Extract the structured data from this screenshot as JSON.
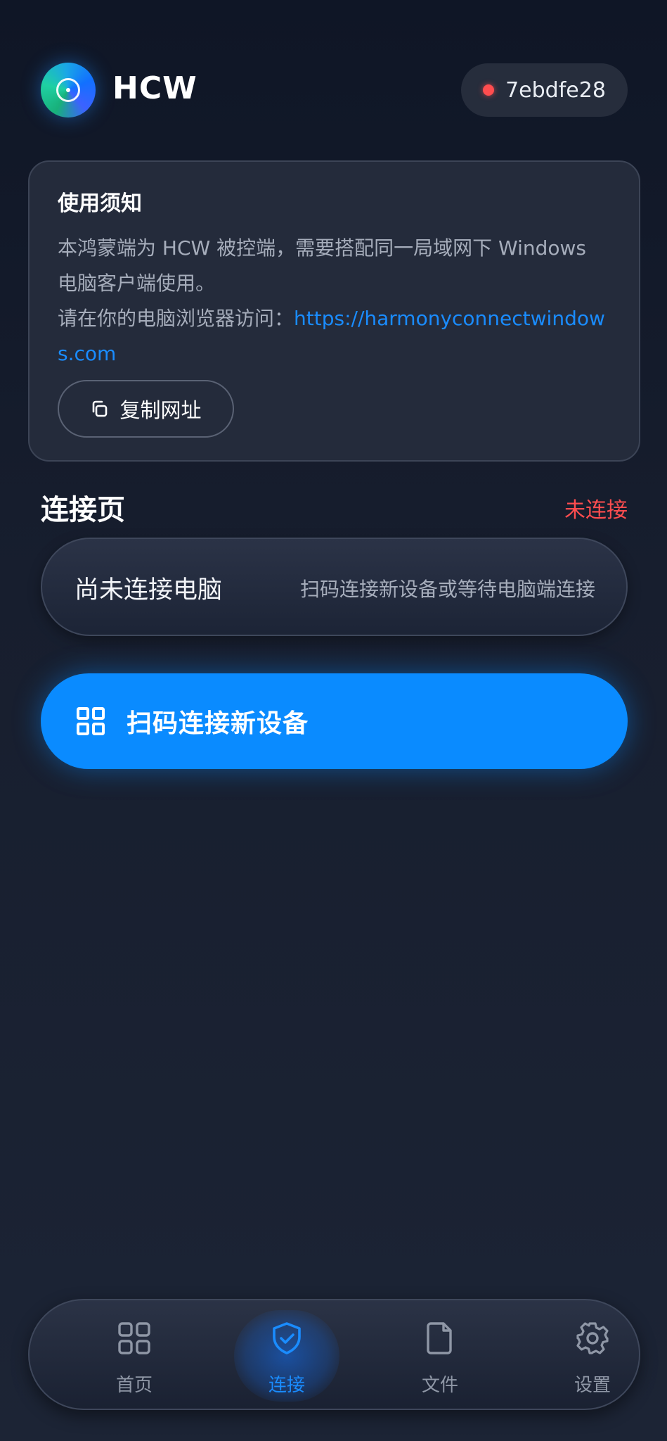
{
  "header": {
    "app_title": "HCW",
    "device_id": "7ebdfe28",
    "status_color": "#ff4d4f"
  },
  "notice": {
    "title": "使用须知",
    "line1": "本鸿蒙端为 HCW 被控端，需要搭配同一局域网下 Windows 电脑客户端使用。",
    "line2_prefix": "请在你的电脑浏览器访问：",
    "url": "https://harmonyconnectwindows.com",
    "copy_label": "复制网址",
    "copy_icon": "copy-icon"
  },
  "connection": {
    "section_title": "连接页",
    "status": "未连接",
    "card_main": "尚未连接电脑",
    "card_hint": "扫码连接新设备或等待电脑端连接",
    "scan_label": "扫码连接新设备",
    "scan_icon": "grid-icon"
  },
  "nav": {
    "items": [
      {
        "label": "首页",
        "icon": "grid-icon",
        "active": false
      },
      {
        "label": "连接",
        "icon": "shield-check-icon",
        "active": true
      },
      {
        "label": "文件",
        "icon": "file-icon",
        "active": false
      },
      {
        "label": "设置",
        "icon": "gear-icon",
        "active": false
      }
    ]
  },
  "colors": {
    "accent": "#0a8bff",
    "link": "#1a8cff",
    "danger": "#ff4d4f",
    "background": "#151c2b"
  }
}
